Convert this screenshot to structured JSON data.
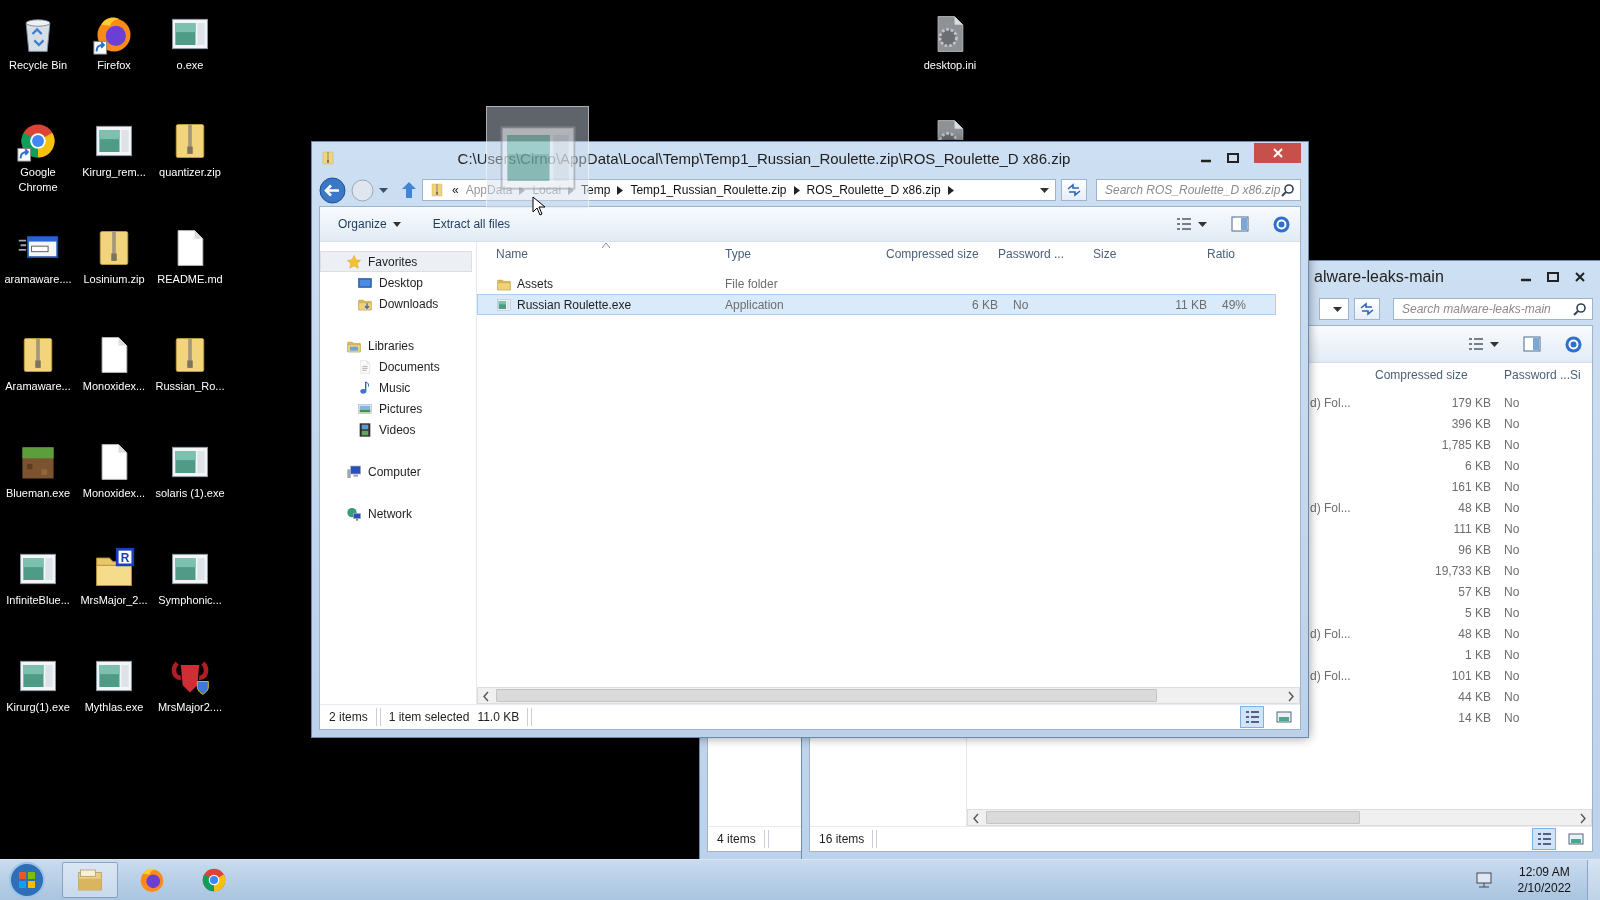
{
  "desktop": {
    "icons": [
      {
        "label": "Recycle Bin",
        "kind": "recycle"
      },
      {
        "label": "Firefox",
        "kind": "firefox",
        "shortcut": true
      },
      {
        "label": "o.exe",
        "kind": "app"
      },
      {
        "label": "Google Chrome",
        "kind": "chrome",
        "shortcut": true
      },
      {
        "label": "Kirurg_rem...",
        "kind": "app"
      },
      {
        "label": "quantizer.zip",
        "kind": "zip"
      },
      {
        "label": "aramaware....",
        "kind": "aramaware"
      },
      {
        "label": "Losinium.zip",
        "kind": "zip"
      },
      {
        "label": "README.md",
        "kind": "doc"
      },
      {
        "label": "Aramaware...",
        "kind": "zip"
      },
      {
        "label": "Monoxidex...",
        "kind": "doc"
      },
      {
        "label": "Russian_Ro...",
        "kind": "zip"
      },
      {
        "label": "Blueman.exe",
        "kind": "block"
      },
      {
        "label": "Monoxidex...",
        "kind": "doc"
      },
      {
        "label": "solaris (1).exe",
        "kind": "app"
      },
      {
        "label": "InfiniteBlue...",
        "kind": "app"
      },
      {
        "label": "MrsMajor_2...",
        "kind": "badgefolder",
        "badge": true
      },
      {
        "label": "Symphonic...",
        "kind": "app"
      },
      {
        "label": "Kirurg(1).exe",
        "kind": "app"
      },
      {
        "label": "Mythlas.exe",
        "kind": "app"
      },
      {
        "label": "MrsMajor2....",
        "kind": "ram"
      }
    ],
    "badge_letter": "R",
    "loose_icons": [
      {
        "label": "desktop.ini",
        "kind": "ini"
      },
      {
        "kind": "ini"
      }
    ]
  },
  "explorer": {
    "title": "C:\\Users\\Cirno\\AppData\\Local\\Temp\\Temp1_Russian_Roulette.zip\\ROS_Roulette_D x86.zip",
    "breadcrumb": {
      "overflow": "«",
      "items": [
        "AppData",
        "Local",
        "Temp",
        "Temp1_Russian_Roulette.zip",
        "ROS_Roulette_D x86.zip"
      ]
    },
    "search": {
      "placeholder": "Search ROS_Roulette_D x86.zip"
    },
    "toolbar": [
      {
        "label": "Organize",
        "dropdown": true
      },
      {
        "label": "Extract all files",
        "dropdown": false
      }
    ],
    "nav": [
      {
        "label": "Favorites",
        "kind": "favorites",
        "selected": true,
        "children": [
          {
            "label": "Desktop",
            "kind": "desktop",
            "selected": false
          },
          {
            "label": "Downloads",
            "kind": "downloads",
            "selected": false
          }
        ]
      },
      {
        "label": "Libraries",
        "kind": "libraries",
        "selected": false,
        "children": [
          {
            "label": "Documents",
            "kind": "documents",
            "selected": false
          },
          {
            "label": "Music",
            "kind": "music",
            "selected": false
          },
          {
            "label": "Pictures",
            "kind": "pictures",
            "selected": false
          },
          {
            "label": "Videos",
            "kind": "videos",
            "selected": false
          }
        ]
      },
      {
        "label": "Computer",
        "kind": "computer",
        "selected": false
      },
      {
        "label": "Network",
        "kind": "network",
        "selected": false
      }
    ],
    "columns": [
      "Name",
      "Type",
      "Compressed size",
      "Password ...",
      "Size",
      "Ratio"
    ],
    "files": [
      {
        "name": "Assets",
        "kind": "folder",
        "type": "File folder",
        "selected": false
      },
      {
        "name": "Russian Roulette.exe",
        "kind": "app",
        "type": "Application",
        "compressed": "6 KB",
        "password": "No",
        "size": "11 KB",
        "ratio": "49%",
        "selected": true
      }
    ],
    "status": {
      "count": "2 items",
      "selection": "1 item selected",
      "selection_size": "11.0 KB"
    }
  },
  "malware_window": {
    "title": "alware-leaks-main",
    "search": {
      "placeholder": "Search malware-leaks-main"
    },
    "columns": [
      "Compressed size",
      "Password ...",
      "Si"
    ],
    "rows": [
      {
        "type": "d) Fol...",
        "compressed": "179 KB",
        "password": "No"
      },
      {
        "compressed": "396 KB",
        "password": "No"
      },
      {
        "compressed": "1,785 KB",
        "password": "No"
      },
      {
        "compressed": "6 KB",
        "password": "No"
      },
      {
        "compressed": "161 KB",
        "password": "No"
      },
      {
        "type": "d) Fol...",
        "compressed": "48 KB",
        "password": "No"
      },
      {
        "compressed": "111 KB",
        "password": "No"
      },
      {
        "compressed": "96 KB",
        "password": "No"
      },
      {
        "compressed": "19,733 KB",
        "password": "No"
      },
      {
        "compressed": "57 KB",
        "password": "No"
      },
      {
        "compressed": "5 KB",
        "password": "No"
      },
      {
        "type": "d) Fol...",
        "compressed": "48 KB",
        "password": "No"
      },
      {
        "compressed": "1 KB",
        "password": "No"
      },
      {
        "type": "d) Fol...",
        "compressed": "101 KB",
        "password": "No"
      },
      {
        "compressed": "44 KB",
        "password": "No"
      },
      {
        "compressed": "14 KB",
        "password": "No"
      }
    ],
    "status": "16 items"
  },
  "other_window": {
    "status": "4 items"
  },
  "taskbar": {
    "apps": [
      {
        "kind": "explorer",
        "running": true
      },
      {
        "kind": "firefox",
        "running": false
      },
      {
        "kind": "chrome",
        "running": false
      }
    ],
    "time": "12:09 AM",
    "date": "2/10/2022"
  }
}
